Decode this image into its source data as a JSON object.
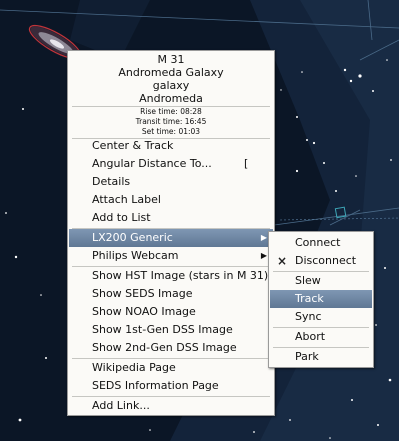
{
  "popup": {
    "object_name": "M 31",
    "common_name": "Andromeda Galaxy",
    "object_type": "galaxy",
    "constellation": "Andromeda",
    "rise_time": "Rise time: 08:28",
    "transit_time": "Transit time: 16:45",
    "set_time": "Set time: 01:03",
    "items": {
      "center_track": "Center & Track",
      "angular_distance": "Angular Distance To...",
      "angular_distance_shortcut": "[",
      "details": "Details",
      "attach_label": "Attach Label",
      "add_to_list": "Add to List",
      "lx200": "LX200 Generic",
      "philips": "Philips Webcam",
      "hst": "Show HST Image (stars in M 31)",
      "seds_image": "Show SEDS Image",
      "noao": "Show NOAO Image",
      "dss1": "Show 1st-Gen DSS Image",
      "dss2": "Show 2nd-Gen DSS Image",
      "wikipedia": "Wikipedia Page",
      "seds_page": "SEDS Information Page",
      "add_link": "Add Link..."
    },
    "submenu_arrow": "▶"
  },
  "device_menu": {
    "connect": "Connect",
    "disconnect": "Disconnect",
    "disconnect_icon": "×",
    "slew": "Slew",
    "track": "Track",
    "sync": "Sync",
    "abort": "Abort",
    "park": "Park"
  },
  "colors": {
    "sky": "#0b1626",
    "highlight": "#6f87a4",
    "menu_bg": "#fbfaf7",
    "constellation_line": "#4a6a88"
  }
}
